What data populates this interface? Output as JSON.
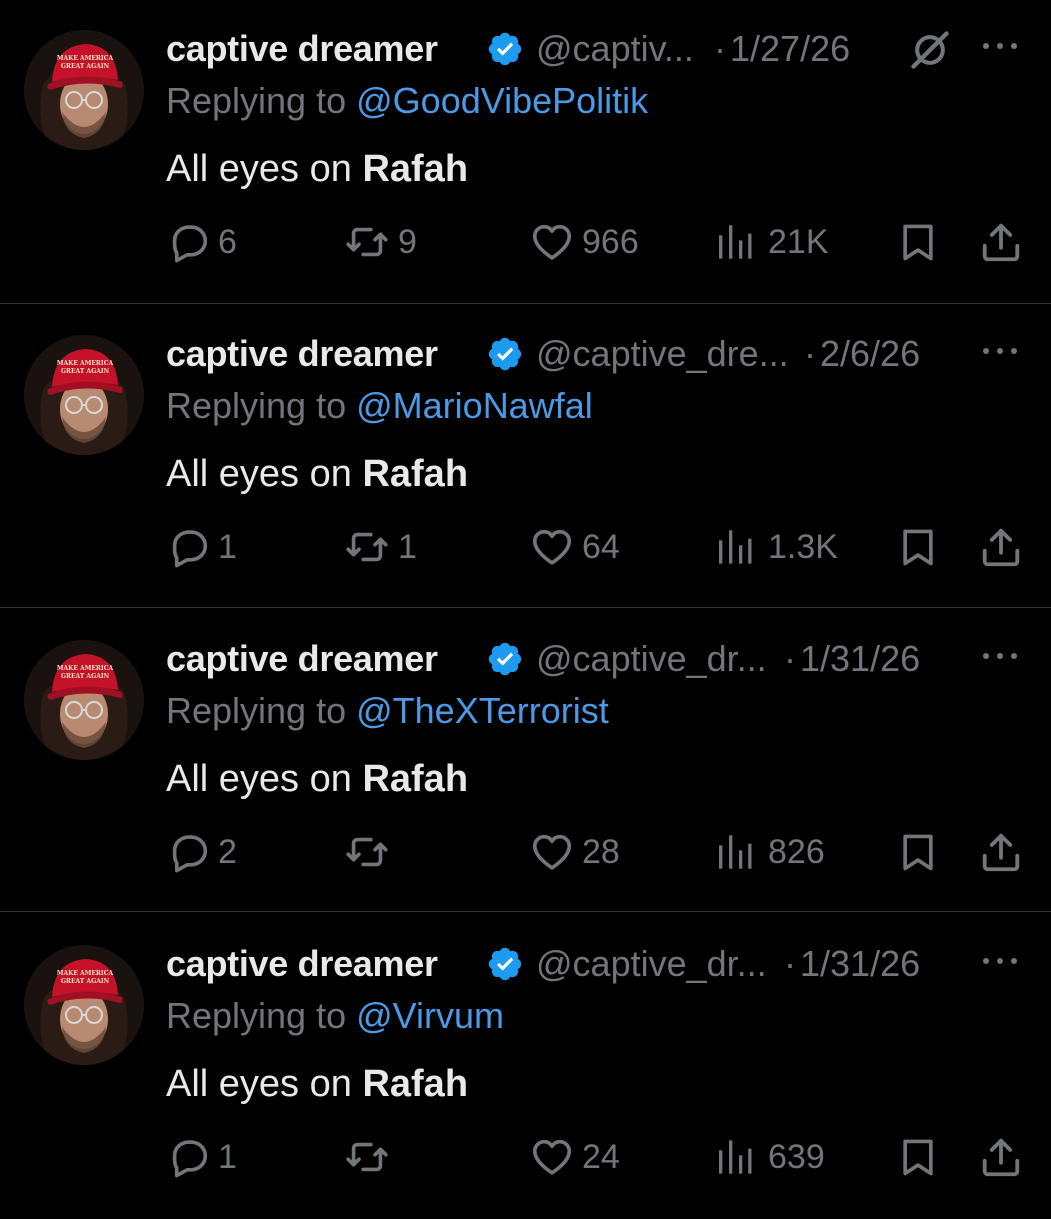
{
  "colors": {
    "background": "#000000",
    "text": "#e7e9ea",
    "muted": "#71767b",
    "link": "#4c99e6",
    "verified": "#1d9bf0",
    "divider": "#2f3336"
  },
  "tweets": [
    {
      "display_name": "captive dreamer",
      "handle": "@captiv...",
      "separator": "·",
      "date": "1/27/26",
      "has_grok_icon": true,
      "replying_prefix": "Replying to",
      "replying_to": "@GoodVibePolitik",
      "text_plain": "All eyes on ",
      "text_bold": "Rafah",
      "replies": "6",
      "reposts": "9",
      "likes": "966",
      "views": "21K"
    },
    {
      "display_name": "captive dreamer",
      "handle": "@captive_dre...",
      "separator": "·",
      "date": "2/6/26",
      "has_grok_icon": false,
      "replying_prefix": "Replying to",
      "replying_to": "@MarioNawfal",
      "text_plain": "All eyes on ",
      "text_bold": "Rafah",
      "replies": "1",
      "reposts": "1",
      "likes": "64",
      "views": "1.3K"
    },
    {
      "display_name": "captive dreamer",
      "handle": "@captive_dr...",
      "separator": "·",
      "date": "1/31/26",
      "has_grok_icon": false,
      "replying_prefix": "Replying to",
      "replying_to": "@TheXTerrorist",
      "text_plain": "All eyes on ",
      "text_bold": "Rafah",
      "replies": "2",
      "reposts": "",
      "likes": "28",
      "views": "826"
    },
    {
      "display_name": "captive dreamer",
      "handle": "@captive_dr...",
      "separator": "·",
      "date": "1/31/26",
      "has_grok_icon": false,
      "replying_prefix": "Replying to",
      "replying_to": "@Virvum",
      "text_plain": "All eyes on ",
      "text_bold": "Rafah",
      "replies": "1",
      "reposts": "",
      "likes": "24",
      "views": "639"
    }
  ],
  "avatar": {
    "hat_text_line1": "MAKE AMERICA",
    "hat_text_line2": "GREAT AGAIN"
  }
}
